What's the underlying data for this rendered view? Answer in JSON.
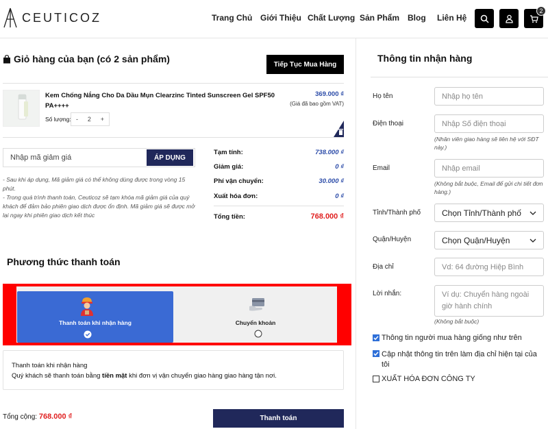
{
  "header": {
    "logo_text": "CEUTICOZ",
    "nav": [
      "Trang Chủ",
      "Giới Thiệu",
      "Chất Lượng",
      "Sản Phẩm",
      "Blog",
      "Liên Hệ"
    ],
    "cart_count": "2"
  },
  "cart": {
    "title": "Giỏ hàng của bạn (có 2 sản phẩm)",
    "continue_label": "Tiếp Tục Mua Hàng",
    "item": {
      "name": "Kem Chống Nắng Cho Da Dầu Mụn Clearzinc Tinted Sunscreen Gel SPF50 PA++++",
      "qty_label": "Số lượng:",
      "qty_minus": "-",
      "qty_value": "2",
      "qty_plus": "+",
      "price": "369.000 ₫",
      "vat_note": "(Giá đã bao gồm VAT)"
    },
    "coupon_placeholder": "Nhập mã giảm giá",
    "apply_label": "ÁP DỤNG",
    "notes": "- Sau khi áp dụng, Mã giảm giá có thể không dùng được trong vòng 15 phút.\n- Trong quá trình thanh toán, Ceuticoz sẽ tạm khóa mã giảm giá của quý khách để đảm bảo phiên giao dịch được ổn định. Mã giảm giá sẽ được mở lại ngay khi phiên giao dịch kết thúc",
    "summary": {
      "subtotal_label": "Tạm tính:",
      "subtotal": "738.000 ₫",
      "discount_label": "Giảm giá:",
      "discount": "0 ₫",
      "shipping_label": "Phí vận chuyển:",
      "shipping": "30.000 ₫",
      "invoice_label": "Xuất hóa đơn:",
      "invoice": "0 ₫",
      "total_label": "Tổng tiền:",
      "total": "768.000 ₫"
    }
  },
  "payment": {
    "title": "Phương thức thanh toán",
    "options": [
      {
        "label": "Thanh toán khi nhận hàng",
        "selected": true
      },
      {
        "label": "Chuyển khoản",
        "selected": false
      }
    ],
    "desc_title": "Thanh toán khi nhận hàng",
    "desc_prefix": "Quý khách sẽ thanh toán bằng",
    "desc_bold": "tiền mặt",
    "desc_suffix": "khi đơn vị vận chuyển giao hàng giao hàng tận nơi.",
    "grand_total_label": "Tổng cộng:",
    "grand_total": "768.000 ₫",
    "pay_label": "Thanh toán"
  },
  "shipping_info": {
    "title": "Thông tin nhận hàng",
    "name_label": "Họ tên",
    "name_placeholder": "Nhập họ tên",
    "phone_label": "Điện thoại",
    "phone_placeholder": "Nhập Số điện thoại",
    "phone_hint": "(Nhân viên giao hàng sẽ liên hệ với SĐT này.)",
    "email_label": "Email",
    "email_placeholder": "Nhập email",
    "email_hint": "(Không bắt buộc, Email để gửi chi tiết đơn hàng.)",
    "province_label": "Tỉnh/Thành phố",
    "province_value": "Chọn Tỉnh/Thành phố",
    "district_label": "Quận/Huyện",
    "district_value": "Chọn Quận/Huyện",
    "address_label": "Địa chỉ",
    "address_placeholder": "Vd: 64 đường Hiệp Bình",
    "message_label": "Lời nhắn:",
    "message_placeholder": "Ví dụ: Chuyển hàng ngoài giờ hành chính",
    "message_hint": "(Không bắt buộc)",
    "check_same_buyer": "Thông tin người mua hàng giống như trên",
    "check_update_address": "Cập nhật thông tin trên làm địa chỉ hiện tại của tôi",
    "check_invoice": "XUẤT HÓA ĐƠN CÔNG TY"
  },
  "colors": {
    "accent": "#20285a",
    "price_blue": "#2b4ba8",
    "total_red": "#e02020",
    "selected_blue": "#3a6ad4",
    "highlight_red": "#ff0000"
  }
}
